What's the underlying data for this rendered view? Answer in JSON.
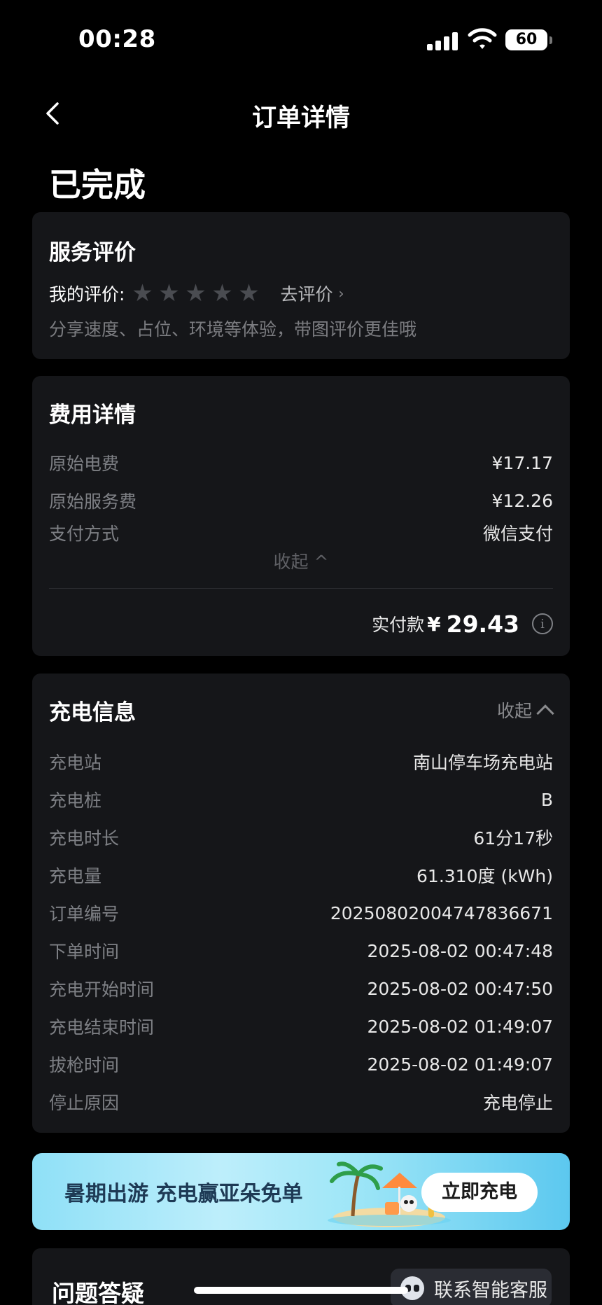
{
  "status_bar": {
    "time": "00:28",
    "battery": "60"
  },
  "nav": {
    "title": "订单详情"
  },
  "order_status": "已完成",
  "rating": {
    "title": "服务评价",
    "my_rating_label": "我的评价:",
    "stars": 5,
    "go_rate_label": "去评价",
    "hint": "分享速度、占位、环境等体验，带图评价更佳哦"
  },
  "fee": {
    "title": "费用详情",
    "items": [
      {
        "label": "原始电费",
        "value": "¥17.17"
      },
      {
        "label": "原始服务费",
        "value": "¥12.26"
      },
      {
        "label": "支付方式",
        "value": "微信支付"
      }
    ],
    "collapse_label": "收起",
    "paid_label": "实付款",
    "paid_currency": "¥",
    "paid_amount": "29.43"
  },
  "charge": {
    "title": "充电信息",
    "collapse_label": "收起",
    "items": [
      {
        "label": "充电站",
        "value": "南山停车场充电站"
      },
      {
        "label": "充电桩",
        "value": "B"
      },
      {
        "label": "充电时长",
        "value": "61分17秒"
      },
      {
        "label": "充电量",
        "value": "61.310度 (kWh)"
      },
      {
        "label": "订单编号",
        "value": "20250802004747836671"
      },
      {
        "label": "下单时间",
        "value": "2025-08-02 00:47:48"
      },
      {
        "label": "充电开始时间",
        "value": "2025-08-02 00:47:50"
      },
      {
        "label": "充电结束时间",
        "value": "2025-08-02 01:49:07"
      },
      {
        "label": "拔枪时间",
        "value": "2025-08-02 01:49:07"
      },
      {
        "label": "停止原因",
        "value": "充电停止"
      }
    ]
  },
  "banner": {
    "text": "暑期出游 充电赢亚朵免单",
    "button": "立即充电"
  },
  "faq": {
    "title": "问题答疑"
  },
  "service": {
    "label": "联系智能客服"
  }
}
